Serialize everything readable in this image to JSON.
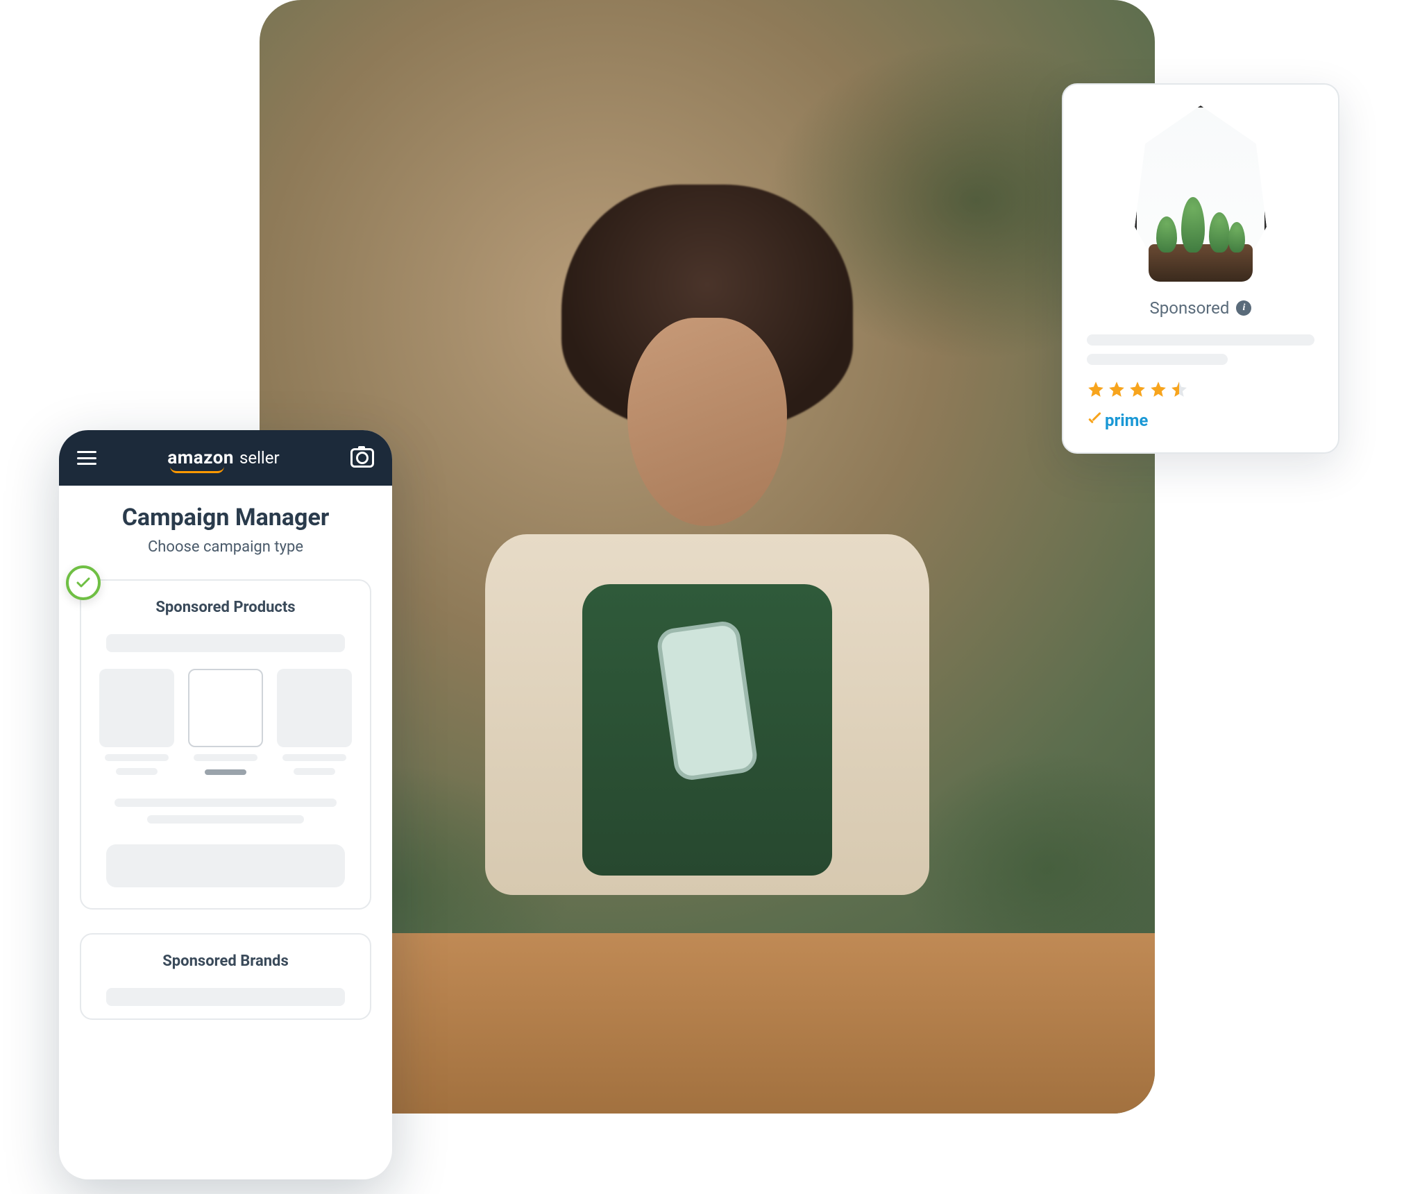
{
  "hero": {
    "alt": "Smiling plant-shop owner in a green apron looking at her phone among terrariums and foliage"
  },
  "phone": {
    "brand_main": "amazon",
    "brand_sub": "seller",
    "menu_icon": "hamburger-icon",
    "camera_icon": "camera-icon",
    "title": "Campaign Manager",
    "subtitle": "Choose campaign type",
    "options": [
      {
        "label": "Sponsored Products",
        "selected": true
      },
      {
        "label": "Sponsored Brands",
        "selected": false
      }
    ]
  },
  "sponsored_card": {
    "label": "Sponsored",
    "info_icon": "info-icon",
    "rating": 4.5,
    "rating_max": 5,
    "prime_label": "prime",
    "product_alt": "Geometric glass terrarium with succulents"
  },
  "colors": {
    "header_bg": "#1c2a3a",
    "accent_green": "#6fbf44",
    "star": "#f7a41d",
    "prime_blue": "#1a98d5",
    "text": "#2a3b4c"
  }
}
